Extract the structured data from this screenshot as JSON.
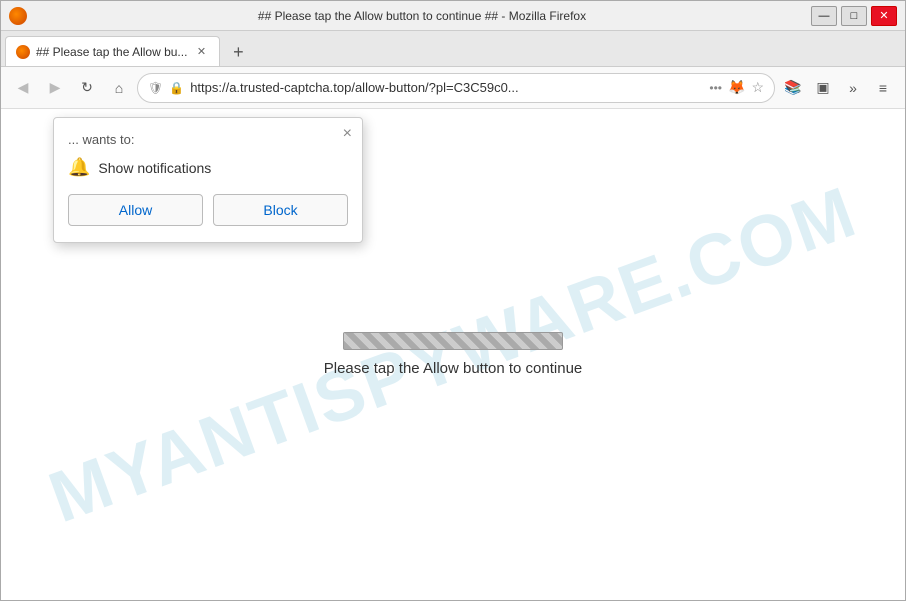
{
  "window": {
    "title": "## Please tap the Allow button to continue ## - Mozilla Firefox",
    "controls": {
      "minimize": "—",
      "maximize": "□",
      "close": "✕"
    }
  },
  "tab": {
    "title": "## Please tap the Allow bu...",
    "close": "✕"
  },
  "new_tab_btn": "+",
  "navbar": {
    "back": "◀",
    "forward": "▶",
    "reload": "↻",
    "home": "⌂",
    "shield": "🛡",
    "lock": "🔒",
    "url": "https://a.trusted-captcha.top/allow-button/?pl=C3C59c0...",
    "more": "•••",
    "bookmark": "☆",
    "library": "📚",
    "sidebar": "▣",
    "extensions": "»",
    "menu": "≡"
  },
  "popup": {
    "wants_text": "... wants to:",
    "close": "×",
    "notification_label": "Show notifications",
    "allow_btn": "Allow",
    "block_btn": "Block"
  },
  "page": {
    "message": "Please tap the Allow button to continue"
  },
  "watermark": "MYANTISPYWARE.COM"
}
